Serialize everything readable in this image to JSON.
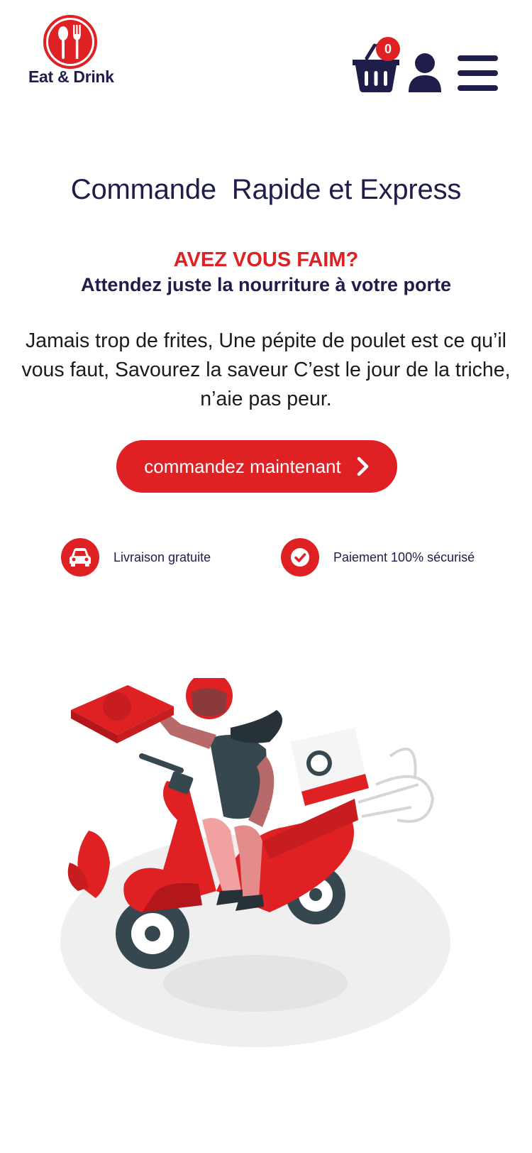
{
  "header": {
    "logo_text": "Eat & Drink",
    "cart_count": "0",
    "icons": [
      "fork-spoon-icon",
      "basket-icon",
      "user-icon",
      "hamburger-menu-icon"
    ]
  },
  "hero": {
    "title": "Commande  Rapide et Express",
    "question": "AVEZ VOUS FAIM?",
    "subtitle": "Attendez juste la nourriture à votre porte",
    "body": "Jamais trop de frites, Une pépite de poulet est ce qu’il vous faut, Savourez la saveur C’est le jour de la triche, n’aie pas peur.",
    "cta_label": "commandez maintenant"
  },
  "features": [
    {
      "icon": "car-icon",
      "label": "Livraison gratuite"
    },
    {
      "icon": "check-circle-icon",
      "label": "Paiement 100% sécurisé"
    }
  ],
  "colors": {
    "accent": "#e02124",
    "navy": "#1f1d4a",
    "text": "#1b1b1b",
    "background": "#ffffff"
  }
}
